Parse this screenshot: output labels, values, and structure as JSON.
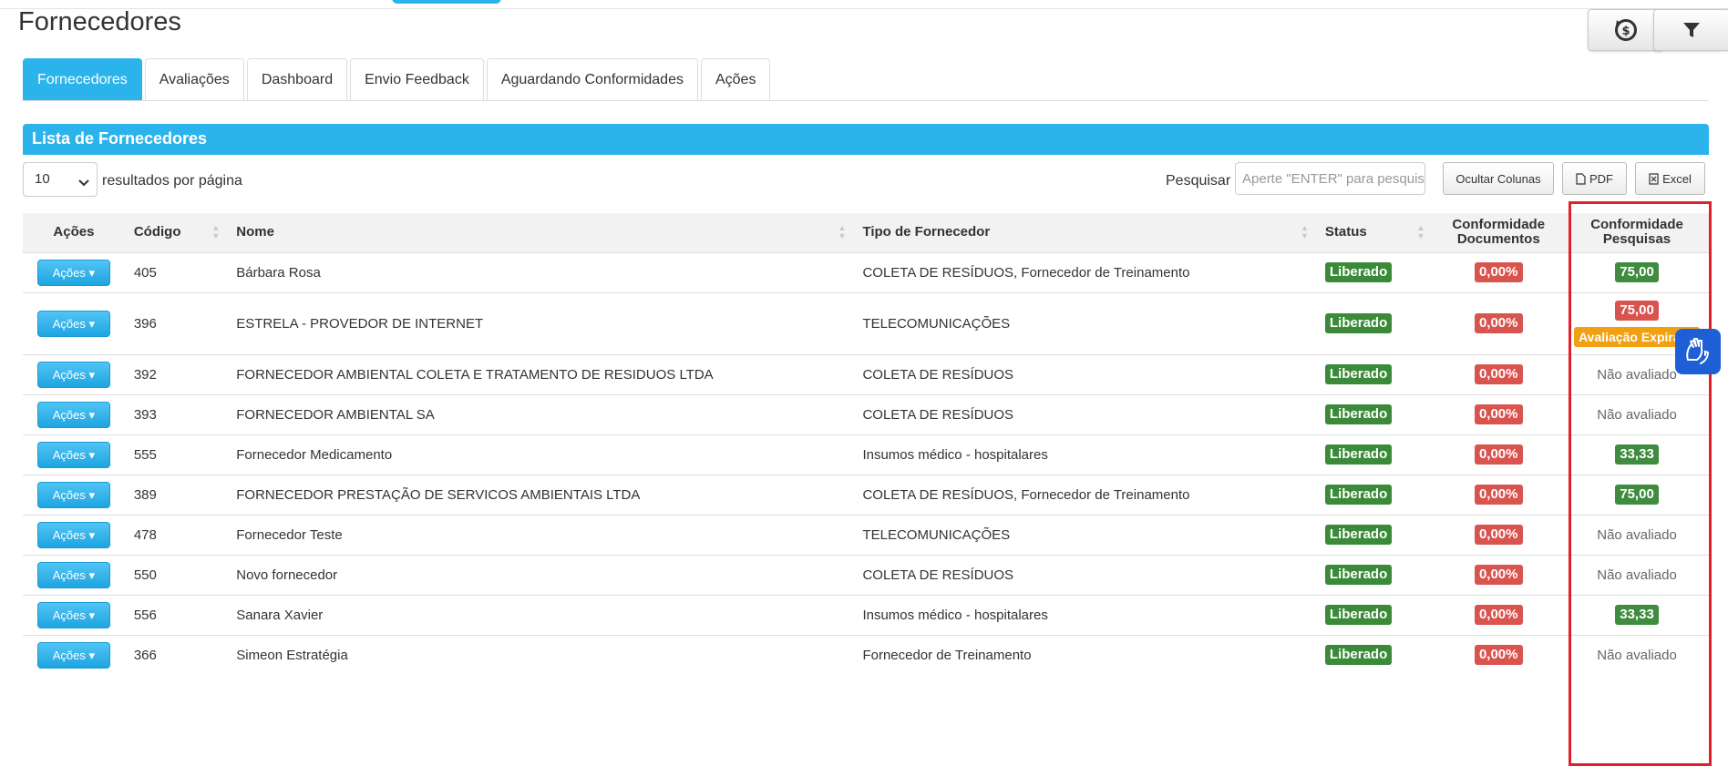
{
  "header": {
    "title": "Fornecedores"
  },
  "tabs": [
    {
      "label": "Fornecedores",
      "active": true
    },
    {
      "label": "Avaliações",
      "active": false
    },
    {
      "label": "Dashboard",
      "active": false
    },
    {
      "label": "Envio Feedback",
      "active": false
    },
    {
      "label": "Aguardando Conformidades",
      "active": false
    },
    {
      "label": "Ações",
      "active": false
    }
  ],
  "panel": {
    "title": "Lista de Fornecedores"
  },
  "controls": {
    "page_length": "10",
    "page_length_label": "resultados por página",
    "search_label": "Pesquisar",
    "search_placeholder": "Aperte \"ENTER\" para pesquisar",
    "hide_columns": "Ocultar Colunas",
    "pdf": "PDF",
    "excel": "Excel"
  },
  "table": {
    "headers": {
      "acoes": "Ações",
      "codigo": "Código",
      "nome": "Nome",
      "tipo": "Tipo de Fornecedor",
      "status": "Status",
      "conf_doc_1": "Conformidade",
      "conf_doc_2": "Documentos",
      "conf_pesq_1": "Conformidade",
      "conf_pesq_2": "Pesquisas"
    },
    "action_label": "Ações",
    "rows": [
      {
        "codigo": "405",
        "nome": "Bárbara Rosa",
        "tipo": "COLETA DE RESÍDUOS, Fornecedor de Treinamento",
        "status": "Liberado",
        "conf_doc": "0,00%",
        "conf_pesq": "75,00",
        "pesq_color": "green"
      },
      {
        "codigo": "396",
        "nome": "ESTRELA - PROVEDOR DE INTERNET",
        "tipo": "TELECOMUNICAÇÕES",
        "status": "Liberado",
        "conf_doc": "0,00%",
        "conf_pesq": "75,00",
        "pesq_color": "red",
        "pesq_extra": "Avaliação Expirada"
      },
      {
        "codigo": "392",
        "nome": "FORNECEDOR AMBIENTAL COLETA E TRATAMENTO DE RESIDUOS LTDA",
        "tipo": "COLETA DE RESÍDUOS",
        "status": "Liberado",
        "conf_doc": "0,00%",
        "conf_pesq": "Não avaliado",
        "pesq_color": "none"
      },
      {
        "codigo": "393",
        "nome": "FORNECEDOR AMBIENTAL SA",
        "tipo": "COLETA DE RESÍDUOS",
        "status": "Liberado",
        "conf_doc": "0,00%",
        "conf_pesq": "Não avaliado",
        "pesq_color": "none"
      },
      {
        "codigo": "555",
        "nome": "Fornecedor Medicamento",
        "tipo": "Insumos médico - hospitalares",
        "status": "Liberado",
        "conf_doc": "0,00%",
        "conf_pesq": "33,33",
        "pesq_color": "green"
      },
      {
        "codigo": "389",
        "nome": "FORNECEDOR PRESTAÇÃO DE SERVICOS AMBIENTAIS LTDA",
        "tipo": "COLETA DE RESÍDUOS, Fornecedor de Treinamento",
        "status": "Liberado",
        "conf_doc": "0,00%",
        "conf_pesq": "75,00",
        "pesq_color": "green"
      },
      {
        "codigo": "478",
        "nome": "Fornecedor Teste",
        "tipo": "TELECOMUNICAÇÕES",
        "status": "Liberado",
        "conf_doc": "0,00%",
        "conf_pesq": "Não avaliado",
        "pesq_color": "none"
      },
      {
        "codigo": "550",
        "nome": "Novo fornecedor",
        "tipo": "COLETA DE RESÍDUOS",
        "status": "Liberado",
        "conf_doc": "0,00%",
        "conf_pesq": "Não avaliado",
        "pesq_color": "none"
      },
      {
        "codigo": "556",
        "nome": "Sanara Xavier",
        "tipo": "Insumos médico - hospitalares",
        "status": "Liberado",
        "conf_doc": "0,00%",
        "conf_pesq": "33,33",
        "pesq_color": "green"
      },
      {
        "codigo": "366",
        "nome": "Simeon Estratégia",
        "tipo": "Fornecedor de Treinamento",
        "status": "Liberado",
        "conf_doc": "0,00%",
        "conf_pesq": "Não avaliado",
        "pesq_color": "none"
      }
    ]
  },
  "colors": {
    "primary": "#2bb3ec",
    "success": "#3f8b3f",
    "danger": "#d9534f",
    "warning": "#f0a010",
    "highlight": "#e0212b"
  },
  "icons": {
    "refresh": "refresh-dollar-icon",
    "filter": "filter-icon",
    "accessibility": "sign-language-hands-icon"
  }
}
